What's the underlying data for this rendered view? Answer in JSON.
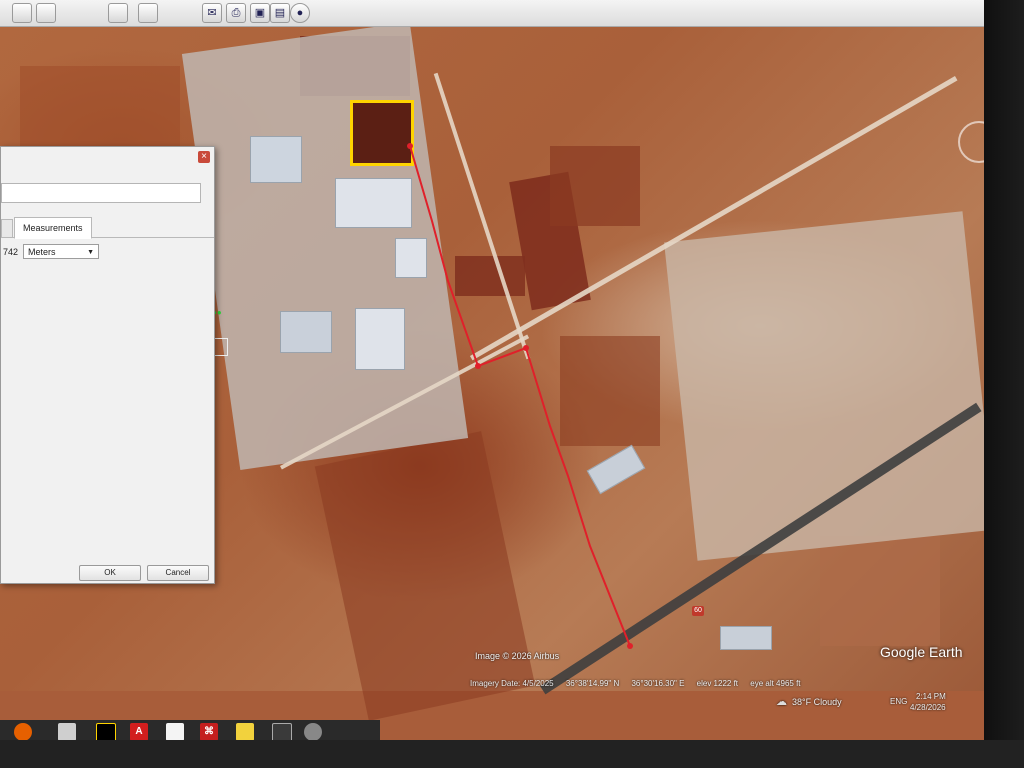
{
  "toolbar": {
    "icons": [
      "email-icon",
      "print-icon",
      "save-image-icon",
      "gallery-icon",
      "earth-icon"
    ]
  },
  "dialog": {
    "tab_label": "Measurements",
    "measure_value_partial": "742",
    "unit": "Meters",
    "ok_label": "OK",
    "cancel_label": "Cancel"
  },
  "map": {
    "watermark": "Google Earth",
    "copyright": "Image © 2026 Airbus",
    "route_badge": "60"
  },
  "status": {
    "imagery_date": "Imagery Date: 4/5/2025",
    "lat": "36°38'14.99\" N",
    "lon": "36°30'16.30\" E",
    "elev": "elev 1222 ft",
    "eye_alt": "eye alt 4965 ft"
  },
  "tray": {
    "weather": "38°F  Cloudy",
    "lang": "ENG",
    "time": "2:14 PM",
    "date": "4/28/2026"
  },
  "taskbar": {
    "apps": [
      "firefox-icon",
      "calculator-icon",
      "sticky-notes-icon",
      "autocad-icon",
      "blank-doc-icon",
      "acrobat-icon",
      "file-icon",
      "photos-icon",
      "google-earth-icon"
    ]
  },
  "colors": {
    "route": "#e0202a",
    "highlight": "#ffd400",
    "soil": "#a85d3a"
  }
}
